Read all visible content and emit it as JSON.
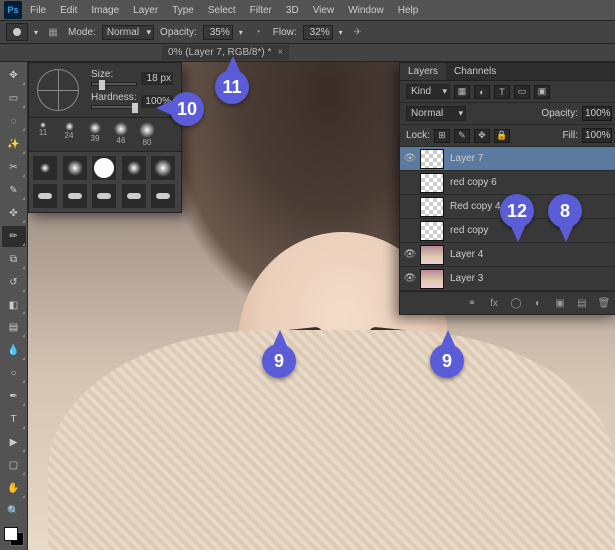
{
  "menu": {
    "items": [
      "File",
      "Edit",
      "Image",
      "Layer",
      "Type",
      "Select",
      "Filter",
      "3D",
      "View",
      "Window",
      "Help"
    ]
  },
  "options": {
    "mode_label": "Mode:",
    "mode_value": "Normal",
    "opacity_label": "Opacity:",
    "opacity_value": "35%",
    "flow_label": "Flow:",
    "flow_value": "32%"
  },
  "doc": {
    "title": "0% (Layer 7, RGB/8*) *"
  },
  "brush": {
    "size_label": "Size:",
    "size_value": "18 px",
    "hardness_label": "Hardness:",
    "hardness_value": "100%",
    "preset_sizes": [
      "11",
      "24",
      "39",
      "46",
      "80"
    ]
  },
  "layers": {
    "tab1": "Layers",
    "tab2": "Channels",
    "kind_value": "Kind",
    "blend_value": "Normal",
    "opacity_label": "Opacity:",
    "opacity_value": "100%",
    "lock_label": "Lock:",
    "fill_label": "Fill:",
    "fill_value": "100%",
    "items": [
      {
        "name": "Layer 7",
        "visible": true,
        "selected": true,
        "img": false
      },
      {
        "name": "red copy 6",
        "visible": false,
        "selected": false,
        "img": false
      },
      {
        "name": "Red copy 4",
        "visible": false,
        "selected": false,
        "img": false
      },
      {
        "name": "red copy",
        "visible": false,
        "selected": false,
        "img": false
      },
      {
        "name": "Layer 4",
        "visible": true,
        "selected": false,
        "img": true
      },
      {
        "name": "Layer 3",
        "visible": true,
        "selected": false,
        "img": true
      }
    ]
  },
  "callouts": {
    "c8": "8",
    "c9": "9",
    "c10": "10",
    "c11": "11",
    "c12": "12"
  }
}
